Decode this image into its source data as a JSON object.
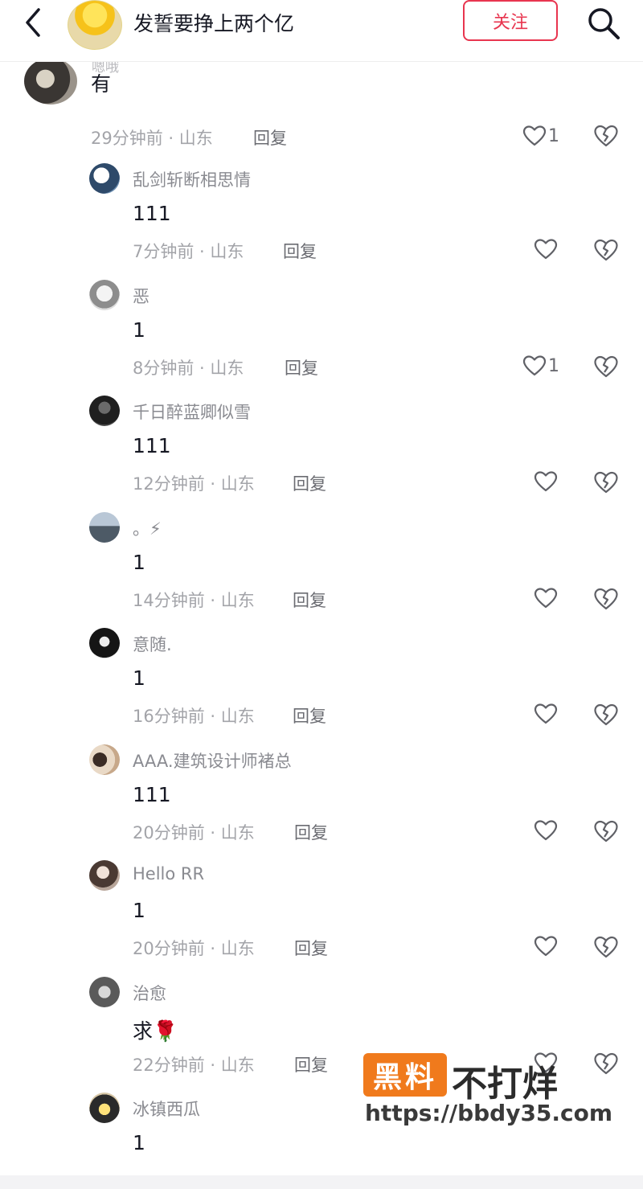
{
  "header": {
    "title": "发誓要挣上两个亿",
    "follow_label": "关注",
    "accent": "#e8354f"
  },
  "top_comment": {
    "username": "嗯哦",
    "text": "有",
    "time_location": "29分钟前 · 山东",
    "reply_label": "回复",
    "likes": "1"
  },
  "replies": [
    {
      "username": "乱剑斩断相思情",
      "text": "111",
      "time_location": "7分钟前 · 山东",
      "reply_label": "回复",
      "likes": ""
    },
    {
      "username": "恶",
      "text": "1",
      "time_location": "8分钟前 · 山东",
      "reply_label": "回复",
      "likes": "1"
    },
    {
      "username": "千日醉蓝卿似雪",
      "text": "111",
      "time_location": "12分钟前 · 山东",
      "reply_label": "回复",
      "likes": ""
    },
    {
      "username": "。⚡",
      "text": "1",
      "time_location": "14分钟前 · 山东",
      "reply_label": "回复",
      "likes": ""
    },
    {
      "username": "意随.",
      "text": "1",
      "time_location": "16分钟前 · 山东",
      "reply_label": "回复",
      "likes": ""
    },
    {
      "username": "AAA.建筑设计师褚总",
      "text": "111",
      "time_location": "20分钟前 · 山东",
      "reply_label": "回复",
      "likes": ""
    },
    {
      "username": "Hello RR",
      "text": "1",
      "time_location": "20分钟前 · 山东",
      "reply_label": "回复",
      "likes": ""
    },
    {
      "username": "治愈",
      "text": "求🌹",
      "time_location": "22分钟前 · 山东",
      "reply_label": "回复",
      "likes": ""
    },
    {
      "username": "冰镇西瓜",
      "text": "1",
      "time_location": "",
      "reply_label": "",
      "likes": ""
    }
  ],
  "watermark": {
    "badge": "黑料",
    "text": "不打烊",
    "url": "https://bbdy35.com",
    "badge_color": "#f07a1c"
  }
}
